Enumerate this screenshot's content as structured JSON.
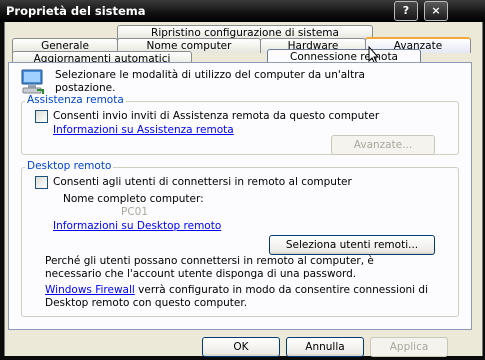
{
  "window": {
    "title": "Proprietà del sistema"
  },
  "titlebar_buttons": {
    "help": "?",
    "close": "×"
  },
  "tabs_row1": [
    "Ripristino configurazione di sistema"
  ],
  "tabs_row2": [
    "Generale",
    "Nome computer",
    "Hardware",
    "Avanzate"
  ],
  "tabs_row3": [
    "Aggiornamenti automatici",
    "Connessione remota"
  ],
  "intro": {
    "line1": "Selezionare le modalità di utilizzo del computer da un'altra",
    "line2": "postazione."
  },
  "assistenza": {
    "label": "Assistenza remota",
    "checkbox": "Consenti invio inviti di Assistenza remota da questo computer",
    "link": "Informazioni su Assistenza remota",
    "advanced_button": "Avanzate..."
  },
  "desktop": {
    "label": "Desktop remoto",
    "checkbox": "Consenti agli utenti di connettersi in remoto al computer",
    "computer_name_label": "Nome completo computer:",
    "computer_name_value": "PC01",
    "link": "Informazioni su Desktop remoto",
    "select_users_button": "Seleziona utenti remoti...",
    "note_line1": "Perché gli utenti possano connettersi in remoto al computer, è",
    "note_line2": "necessario che l'account utente disponga di una password.",
    "firewall_link": "Windows Firewall",
    "firewall_text_line1": " verrà configurato in modo da consentire connessioni di",
    "firewall_text_line2": "Desktop remoto con questo computer."
  },
  "footer": {
    "ok": "OK",
    "cancel": "Annulla",
    "apply": "Applica"
  }
}
